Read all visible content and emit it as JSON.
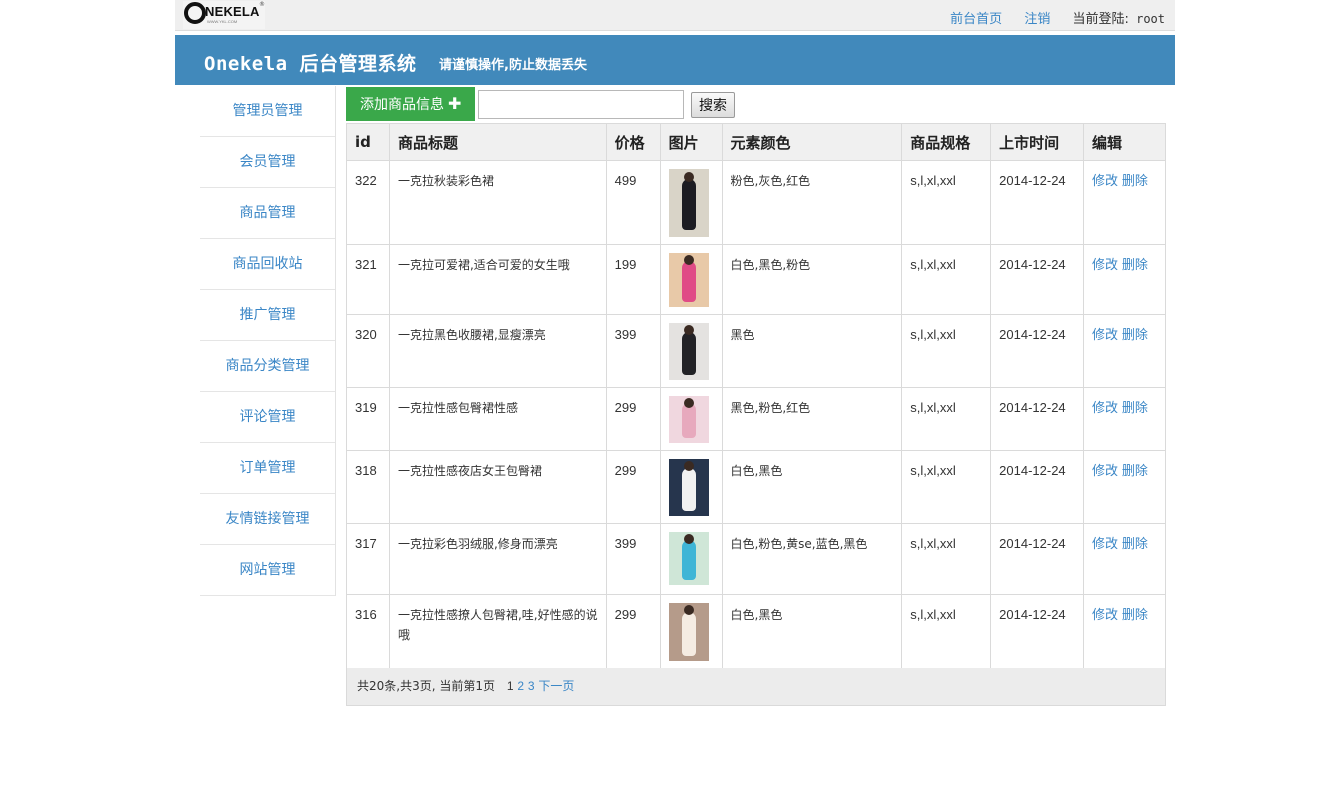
{
  "topbar": {
    "logo_text": "NEKELA",
    "logo_initial": "O",
    "logo_sub": "WWW.YKL.COM",
    "links": [
      {
        "label": "前台首页"
      },
      {
        "label": "注销"
      }
    ],
    "login_label": "当前登陆:",
    "login_user": "root"
  },
  "header": {
    "title": "Onekela 后台管理系统",
    "notice": "请谨慎操作,防止数据丢失"
  },
  "sidebar": {
    "items": [
      {
        "label": "管理员管理"
      },
      {
        "label": "会员管理"
      },
      {
        "label": "商品管理"
      },
      {
        "label": "商品回收站"
      },
      {
        "label": "推广管理"
      },
      {
        "label": "商品分类管理"
      },
      {
        "label": "评论管理"
      },
      {
        "label": "订单管理"
      },
      {
        "label": "友情链接管理"
      },
      {
        "label": "网站管理"
      }
    ]
  },
  "toolbar": {
    "add_label": "添加商品信息",
    "add_icon": "plus-icon",
    "search_value": "",
    "search_label": "搜索"
  },
  "table": {
    "columns": [
      "id",
      "商品标题",
      "价格",
      "图片",
      "元素颜色",
      "商品规格",
      "上市时间",
      "编辑"
    ],
    "rows": [
      {
        "id": "322",
        "title": "一克拉秋装彩色裙",
        "price": "499",
        "colors": "粉色,灰色,红色",
        "spec": "s,l,xl,xxl",
        "date": "2014-12-24",
        "edit": "修改",
        "delete": "删除",
        "img": {
          "bg": "#d9d4c8",
          "fig": "#1c1c22"
        }
      },
      {
        "id": "321",
        "title": "一克拉可爱裙,适合可爱的女生哦",
        "price": "199",
        "colors": "白色,黑色,粉色",
        "spec": "s,l,xl,xxl",
        "date": "2014-12-24",
        "edit": "修改",
        "delete": "删除",
        "img": {
          "bg": "#e8c9a8",
          "fig": "#e04b86"
        }
      },
      {
        "id": "320",
        "title": "一克拉黑色收腰裙,显瘦漂亮",
        "price": "399",
        "colors": "黑色",
        "spec": "s,l,xl,xxl",
        "date": "2014-12-24",
        "edit": "修改",
        "delete": "删除",
        "img": {
          "bg": "#e4e2e0",
          "fig": "#222226"
        }
      },
      {
        "id": "319",
        "title": "一克拉性感包臀裙性感",
        "price": "299",
        "colors": "黑色,粉色,红色",
        "spec": "s,l,xl,xxl",
        "date": "2014-12-24",
        "edit": "修改",
        "delete": "删除",
        "img": {
          "bg": "#f0d7df",
          "fig": "#e7a9bd"
        }
      },
      {
        "id": "318",
        "title": "一克拉性感夜店女王包臀裙",
        "price": "299",
        "colors": "白色,黑色",
        "spec": "s,l,xl,xxl",
        "date": "2014-12-24",
        "edit": "修改",
        "delete": "删除",
        "img": {
          "bg": "#26354d",
          "fig": "#f1f1f1"
        }
      },
      {
        "id": "317",
        "title": "一克拉彩色羽绒服,修身而漂亮",
        "price": "399",
        "colors": "白色,粉色,黄se,蓝色,黑色",
        "spec": "s,l,xl,xxl",
        "date": "2014-12-24",
        "edit": "修改",
        "delete": "删除",
        "img": {
          "bg": "#cfe6d7",
          "fig": "#3fb5d6"
        }
      },
      {
        "id": "316",
        "title": "一克拉性感撩人包臀裙,哇,好性感的说哦",
        "price": "299",
        "colors": "白色,黑色",
        "spec": "s,l,xl,xxl",
        "date": "2014-12-24",
        "edit": "修改",
        "delete": "删除",
        "img": {
          "bg": "#b59b8a",
          "fig": "#f5ece2"
        }
      }
    ]
  },
  "pager": {
    "summary": "共20条,共3页, 当前第1页",
    "current": "1",
    "pages": [
      "2",
      "3"
    ],
    "next_label": "下一页"
  },
  "colors": {
    "header_band": "#4189bb",
    "link": "#3a86c6",
    "add_button": "#3aa84a"
  }
}
